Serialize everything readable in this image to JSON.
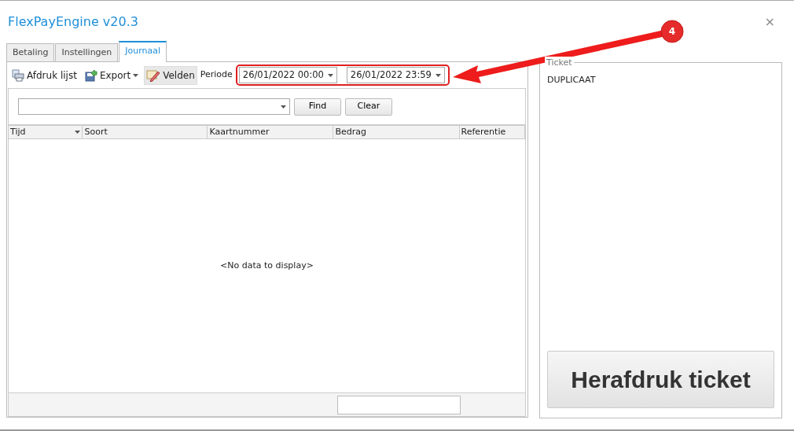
{
  "window": {
    "title": "FlexPayEngine v20.3",
    "close": "×"
  },
  "tabs": [
    {
      "label": "Betaling",
      "selected": false
    },
    {
      "label": "Instellingen",
      "selected": false
    },
    {
      "label": "Journaal",
      "selected": true
    }
  ],
  "toolbar": {
    "print_list": "Afdruk lijst",
    "export": "Export",
    "fields": "Velden",
    "period_label": "Periode",
    "from": "26/01/2022 00:00",
    "to": "26/01/2022 23:59"
  },
  "search": {
    "find": "Find",
    "clear": "Clear"
  },
  "table": {
    "columns": [
      {
        "label": "Tijd",
        "dropdown": true
      },
      {
        "label": "Soort",
        "dropdown": false
      },
      {
        "label": "Kaartnummer",
        "dropdown": false
      },
      {
        "label": "Bedrag",
        "dropdown": false
      },
      {
        "label": "Referentie",
        "dropdown": false
      }
    ],
    "empty": "<No data to display>"
  },
  "ticket": {
    "legend": "Ticket",
    "text": "DUPLICAAT",
    "reprint": "Herafdruk ticket"
  },
  "annotation": {
    "label": "4"
  }
}
